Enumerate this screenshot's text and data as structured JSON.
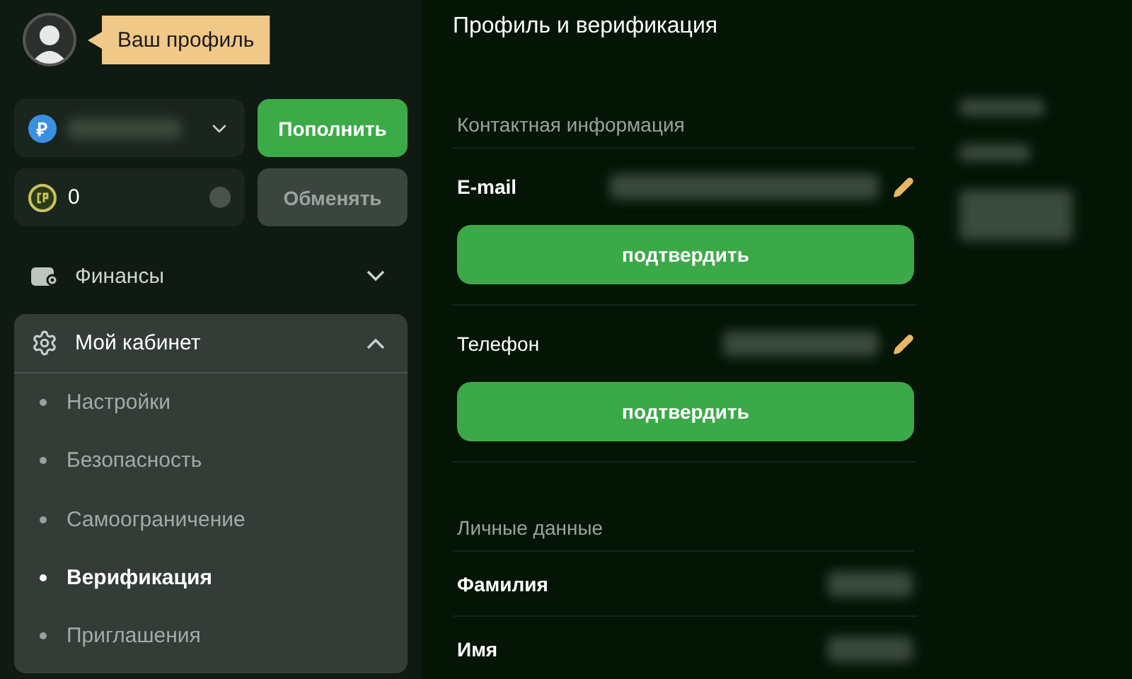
{
  "profile_tooltip": {
    "text": "Ваш профиль"
  },
  "wallet": {
    "currency_icon": "₽",
    "deposit_button": "Пополнить",
    "points": "0",
    "exchange_button": "Обменять",
    "exchange_disabled": true
  },
  "sidebar": {
    "sections": [
      {
        "label": "Финансы",
        "expanded": false
      },
      {
        "label": "Мой кабинет",
        "expanded": true,
        "children": [
          {
            "label": "Настройки",
            "selected": false
          },
          {
            "label": "Безопасность",
            "selected": false
          },
          {
            "label": "Самоограничение",
            "selected": false
          },
          {
            "label": "Верификация",
            "selected": true
          },
          {
            "label": "Приглашения",
            "selected": false
          }
        ]
      }
    ]
  },
  "page_title": "Профиль и верификация",
  "contact": {
    "title": "Контактная информация",
    "fields": [
      {
        "label": "E-mail",
        "button": "подтвердить"
      },
      {
        "label": "Телефон",
        "button": "подтвердить"
      }
    ]
  },
  "personal": {
    "title": "Личные данные",
    "fields": [
      {
        "label": "Фамилия"
      },
      {
        "label": "Имя"
      }
    ]
  }
}
